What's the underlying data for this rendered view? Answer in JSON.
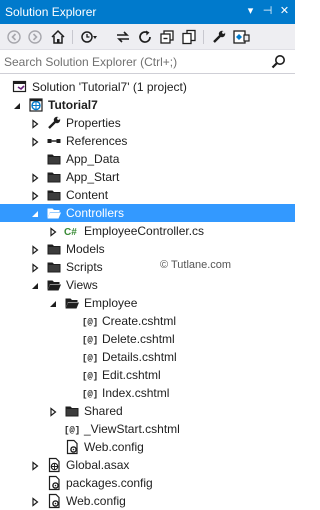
{
  "titlebar": {
    "title": "Solution Explorer",
    "dropdown_glyph": "▾",
    "pin_glyph": "⊣",
    "close_glyph": "✕"
  },
  "search": {
    "placeholder": "Search Solution Explorer (Ctrl+;)",
    "value": ""
  },
  "toolbar": {
    "tools": [
      "back-icon",
      "forward-icon",
      "home-icon",
      "history-icon",
      "sync-icon",
      "refresh-icon",
      "collapse-all-icon",
      "show-all-files-icon",
      "properties-icon",
      "preview-icon"
    ]
  },
  "tree": {
    "items": [
      {
        "label": "Solution 'Tutorial7' (1 project)",
        "icon": "solution-icon",
        "expanded": null,
        "bold": false
      },
      {
        "label": "Tutorial7",
        "icon": "project-icon",
        "expanded": true,
        "bold": true
      },
      {
        "label": "Properties",
        "icon": "wrench-icon",
        "expanded": false,
        "bold": false
      },
      {
        "label": "References",
        "icon": "references-icon",
        "expanded": false,
        "bold": false
      },
      {
        "label": "App_Data",
        "icon": "folder-icon",
        "expanded": null,
        "bold": false
      },
      {
        "label": "App_Start",
        "icon": "folder-icon",
        "expanded": false,
        "bold": false
      },
      {
        "label": "Content",
        "icon": "folder-icon",
        "expanded": false,
        "bold": false
      },
      {
        "label": "Controllers",
        "icon": "folder-open-icon",
        "expanded": true,
        "bold": false,
        "selected": true
      },
      {
        "label": "EmployeeController.cs",
        "icon": "csharp-file-icon",
        "expanded": false,
        "bold": false
      },
      {
        "label": "Models",
        "icon": "folder-icon",
        "expanded": false,
        "bold": false
      },
      {
        "label": "Scripts",
        "icon": "folder-icon",
        "expanded": false,
        "bold": false
      },
      {
        "label": "Views",
        "icon": "folder-open-icon",
        "expanded": true,
        "bold": false
      },
      {
        "label": "Employee",
        "icon": "folder-open-icon",
        "expanded": true,
        "bold": false
      },
      {
        "label": "Create.cshtml",
        "icon": "cshtml-file-icon",
        "expanded": null,
        "bold": false
      },
      {
        "label": "Delete.cshtml",
        "icon": "cshtml-file-icon",
        "expanded": null,
        "bold": false
      },
      {
        "label": "Details.cshtml",
        "icon": "cshtml-file-icon",
        "expanded": null,
        "bold": false
      },
      {
        "label": "Edit.cshtml",
        "icon": "cshtml-file-icon",
        "expanded": null,
        "bold": false
      },
      {
        "label": "Index.cshtml",
        "icon": "cshtml-file-icon",
        "expanded": null,
        "bold": false
      },
      {
        "label": "Shared",
        "icon": "folder-icon",
        "expanded": false,
        "bold": false
      },
      {
        "label": "_ViewStart.cshtml",
        "icon": "cshtml-file-icon",
        "expanded": null,
        "bold": false
      },
      {
        "label": "Web.config",
        "icon": "config-file-icon",
        "expanded": null,
        "bold": false
      },
      {
        "label": "Global.asax",
        "icon": "asax-file-icon",
        "expanded": false,
        "bold": false
      },
      {
        "label": "packages.config",
        "icon": "config-file-icon",
        "expanded": null,
        "bold": false
      },
      {
        "label": "Web.config",
        "icon": "config-file-icon",
        "expanded": false,
        "bold": false
      }
    ]
  },
  "watermark": "© Tutlane.com",
  "colors": {
    "accent": "#007acc",
    "selection": "#3399ff",
    "folder": "#dcb67a"
  }
}
